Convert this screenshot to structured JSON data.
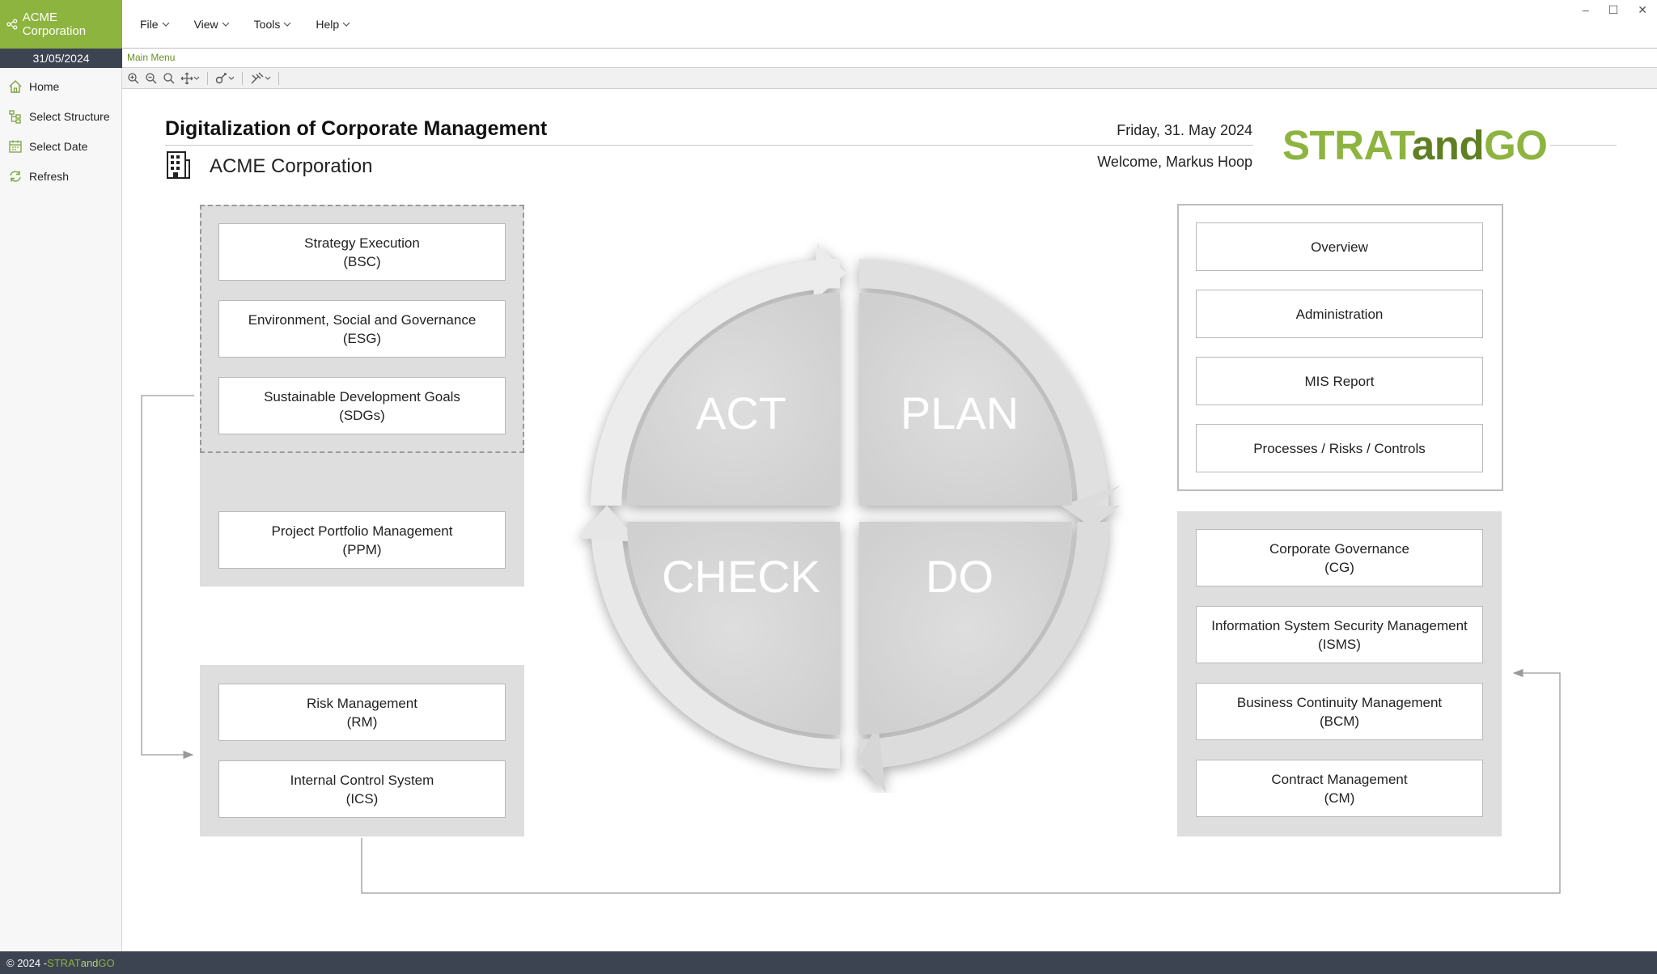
{
  "app": {
    "company": "ACME Corporation",
    "date_short": "31/05/2024"
  },
  "menu": [
    "File",
    "View",
    "Tools",
    "Help"
  ],
  "window_controls": {
    "minimize": "–",
    "maximize": "☐",
    "close": "✕"
  },
  "tab": {
    "main_menu": "Main Menu"
  },
  "sidebar": {
    "items": [
      "Home",
      "Select Structure",
      "Select Date",
      "Refresh"
    ]
  },
  "toolbar": {
    "icons": [
      "zoom-in-icon",
      "zoom-out-icon",
      "zoom-reset-icon",
      "pan-icon",
      "link-tool-icon",
      "edit-tool-icon"
    ]
  },
  "header": {
    "title": "Digitalization of Corporate Management",
    "organization": "ACME Corporation",
    "date_long": "Friday, 31. May 2024",
    "welcome": "Welcome, Markus Hoop",
    "logo_part1": "STRAT",
    "logo_part2": "and",
    "logo_part3": "GO"
  },
  "cycle": {
    "act": "ACT",
    "plan": "PLAN",
    "check": "CHECK",
    "do": "DO"
  },
  "left_top": [
    {
      "line1": "Strategy Execution",
      "line2": "(BSC)"
    },
    {
      "line1": "Environment, Social and Governance",
      "line2": "(ESG)"
    },
    {
      "line1": "Sustainable Development Goals",
      "line2": "(SDGs)"
    },
    {
      "line1": "Project Portfolio Management",
      "line2": "(PPM)"
    }
  ],
  "left_bottom": [
    {
      "line1": "Risk Management",
      "line2": "(RM)"
    },
    {
      "line1": "Internal Control System",
      "line2": "(ICS)"
    }
  ],
  "right_top": [
    "Overview",
    "Administration",
    "MIS Report",
    "Processes / Risks / Controls"
  ],
  "right_bottom": [
    {
      "line1": "Corporate Governance",
      "line2": "(CG)"
    },
    {
      "line1": "Information System Security Management",
      "line2": "(ISMS)"
    },
    {
      "line1": "Business Continuity Management",
      "line2": "(BCM)"
    },
    {
      "line1": "Contract Management",
      "line2": "(CM)"
    }
  ],
  "footer": {
    "copyright": "© 2024 - ",
    "brand1": "STRAT",
    "brand2": "and",
    "brand3": "GO"
  },
  "colors": {
    "brand_green": "#8db43f",
    "brand_dark_green": "#5f7f22",
    "dark_bar": "#3c4351"
  }
}
